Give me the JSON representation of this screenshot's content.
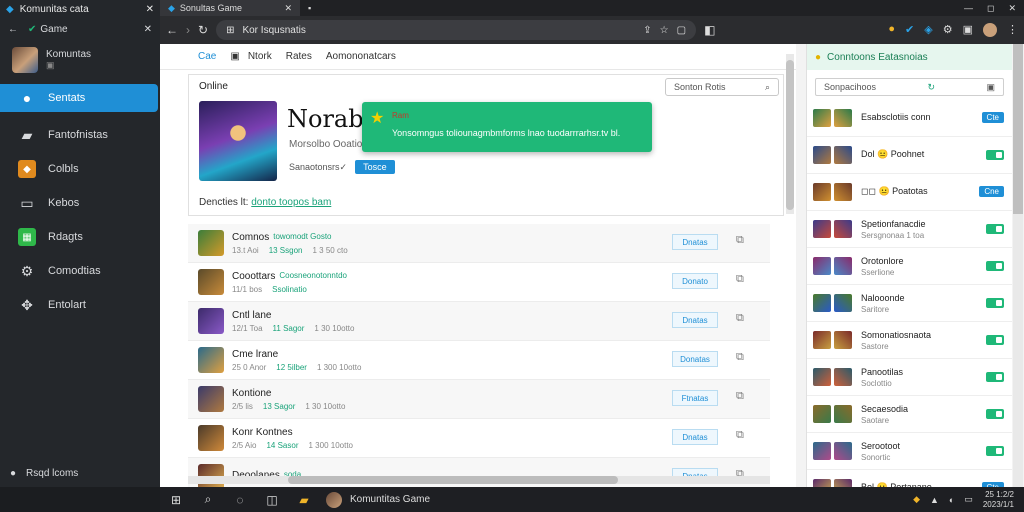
{
  "sidebar": {
    "window_title": "Komunitas cata",
    "nav_label": "Game",
    "profile_name": "Komuntas",
    "profile_sub": "▣",
    "items": [
      {
        "label": "Sentats",
        "icon": "chat-icon",
        "active": true
      },
      {
        "label": "Fantofnistas",
        "icon": "edit-icon"
      },
      {
        "label": "Colbls",
        "icon": "gamepad-icon"
      },
      {
        "label": "Kebos",
        "icon": "folder-icon"
      },
      {
        "label": "Rdagts",
        "icon": "grid-icon"
      },
      {
        "label": "Comodtias",
        "icon": "settings-icon"
      },
      {
        "label": "Entolart",
        "icon": "puzzle-icon"
      }
    ],
    "bottom_label": "Rsqd lcoms"
  },
  "browser": {
    "tab_title": "Sonultas Game",
    "url": "Kor Isqusnatis"
  },
  "page": {
    "tabs": [
      "Cae",
      "Ntork",
      "Rates",
      "Aomononatcars"
    ],
    "online_label": "Online",
    "search_placeholder": "Sonton Rotis",
    "game_title": "Norabim",
    "game_subtitle": "Morsolbo Ooatior",
    "game_meta": "Sanaotonsrs✓",
    "game_button": "Tosce",
    "details_label": "Dencties lt:",
    "details_link": "donto toopos bam"
  },
  "toast": {
    "title": "Ram",
    "message": "Yonsomngus toliounagmbmforms lnao tuodarrrarhsr.tv bl."
  },
  "games": [
    {
      "name": "Comnos",
      "tag": "towomodt Gosto",
      "meta1": "13.t Aoi",
      "meta2": "13 Ssgon",
      "meta3": "1 3 50 cto",
      "button": "Dnatas",
      "colors": [
        "#3b7d3a",
        "#d49a2a"
      ]
    },
    {
      "name": "Cooottars",
      "tag": "Coosneonotonntdo",
      "meta1": "11/1 bos",
      "meta2": "Ssolinatio",
      "meta3": "",
      "button": "Donato",
      "colors": [
        "#5a4a2a",
        "#c88b3a"
      ]
    },
    {
      "name": "Cntl lane",
      "tag": "",
      "meta1": "12/1 Toa",
      "meta2": "11 Sagor",
      "meta3": "1 30 10otto",
      "button": "Dnatas",
      "colors": [
        "#3c2a6a",
        "#8a5ac8"
      ]
    },
    {
      "name": "Cme lrane",
      "tag": "",
      "meta1": "25 0 Anor",
      "meta2": "12 5ilber",
      "meta3": "1 300 10otto",
      "button": "Donatas",
      "colors": [
        "#2a6a8a",
        "#e0a040"
      ]
    },
    {
      "name": "Kontione",
      "tag": "",
      "meta1": "2/5 lis",
      "meta2": "13 Sagor",
      "meta3": "1 30 10otto",
      "button": "Ftnatas",
      "colors": [
        "#3a3a6a",
        "#b07a40"
      ]
    },
    {
      "name": "Konr Kontnes",
      "tag": "",
      "meta1": "2/5 Aio",
      "meta2": "14 Sasor",
      "meta3": "1 300 10otto",
      "button": "Dnatas",
      "colors": [
        "#4a3a2a",
        "#d08a3a"
      ]
    },
    {
      "name": "Deoolanes",
      "tag": "soda",
      "meta1": "",
      "meta2": "",
      "meta3": "",
      "button": "Dnatas",
      "colors": [
        "#5a2a2a",
        "#e0b050"
      ]
    }
  ],
  "right_panel": {
    "header": "Conntoons Eatasnoias",
    "search_placeholder": "Sonpacihoos",
    "friends": [
      {
        "name": "Esabsclotiis conn",
        "sub": "",
        "status": "badge",
        "badge": "Cte"
      },
      {
        "name": "Dol 😐 Poohnet",
        "sub": "",
        "status": "toggle"
      },
      {
        "name": "◻◻ 😐 Poatotas",
        "sub": "",
        "status": "badge",
        "badge": "Cne"
      },
      {
        "name": "Spetionfanacdie",
        "sub": "Sersgnonaa 1 toa",
        "status": "toggle"
      },
      {
        "name": "Orotonlore",
        "sub": "Sserlione",
        "status": "toggle"
      },
      {
        "name": "Nalooonde",
        "sub": "Saritore",
        "status": "toggle"
      },
      {
        "name": "Somonatiosnaota",
        "sub": "Sastore",
        "status": "toggle"
      },
      {
        "name": "Panootilas",
        "sub": "Soclottio",
        "status": "toggle"
      },
      {
        "name": "Secaesodia",
        "sub": "Saotare",
        "status": "toggle"
      },
      {
        "name": "Serootoot",
        "sub": "Sonortic",
        "status": "toggle"
      },
      {
        "name": "Bol 😐 Pertanane",
        "sub": "",
        "status": "badge",
        "badge": "Cte"
      }
    ]
  },
  "taskbar": {
    "app_label": "Komuntitas Game",
    "clock_time": "25 1:2/2",
    "clock_date": "2023/1/1"
  }
}
